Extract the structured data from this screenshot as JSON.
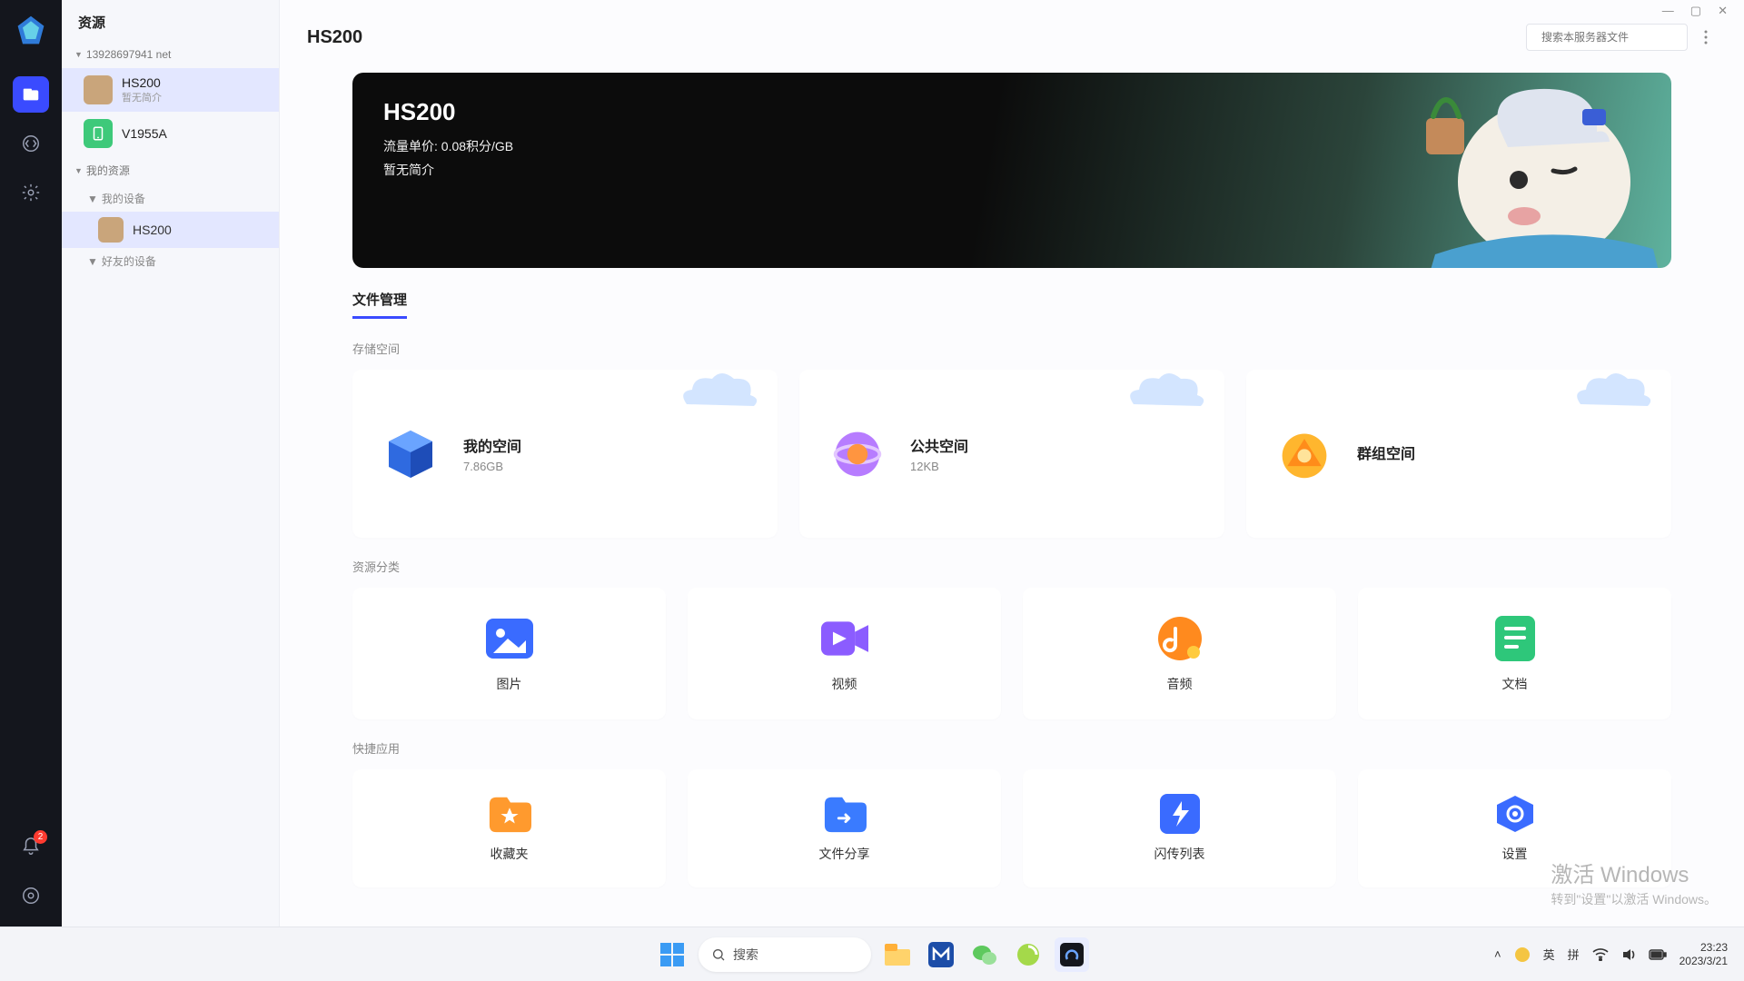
{
  "window": {
    "minimize": "—",
    "maximize": "▢",
    "close": "✕"
  },
  "rail": {
    "badge_count": "2"
  },
  "sidebar": {
    "title": "资源",
    "group1": {
      "label": "13928697941 net",
      "items": [
        {
          "name": "HS200",
          "sub": "暂无简介"
        },
        {
          "name": "V1955A"
        }
      ]
    },
    "group2": {
      "label": "我的资源",
      "sub1": {
        "label": "我的设备",
        "items": [
          {
            "name": "HS200"
          }
        ]
      },
      "sub2": {
        "label": "好友的设备"
      }
    }
  },
  "topbar": {
    "title": "HS200",
    "search_placeholder": "搜索本服务器文件"
  },
  "hero": {
    "title": "HS200",
    "price_line": "流量单价: 0.08积分/GB",
    "desc": "暂无简介"
  },
  "tabs": {
    "file_manage": "文件管理"
  },
  "sections": {
    "storage": "存储空间",
    "category": "资源分类",
    "quick": "快捷应用"
  },
  "storage": [
    {
      "title": "我的空间",
      "size": "7.86GB"
    },
    {
      "title": "公共空间",
      "size": "12KB"
    },
    {
      "title": "群组空间",
      "size": ""
    }
  ],
  "category": [
    {
      "label": "图片"
    },
    {
      "label": "视频"
    },
    {
      "label": "音频"
    },
    {
      "label": "文档"
    }
  ],
  "quick": [
    {
      "label": "收藏夹"
    },
    {
      "label": "文件分享"
    },
    {
      "label": "闪传列表"
    },
    {
      "label": "设置"
    }
  ],
  "watermark": {
    "l1": "激活 Windows",
    "l2": "转到\"设置\"以激活 Windows。"
  },
  "taskbar": {
    "search": "搜索",
    "tray": {
      "ime1": "英",
      "ime2": "拼",
      "time": "23:23",
      "date": "2023/3/21"
    }
  }
}
